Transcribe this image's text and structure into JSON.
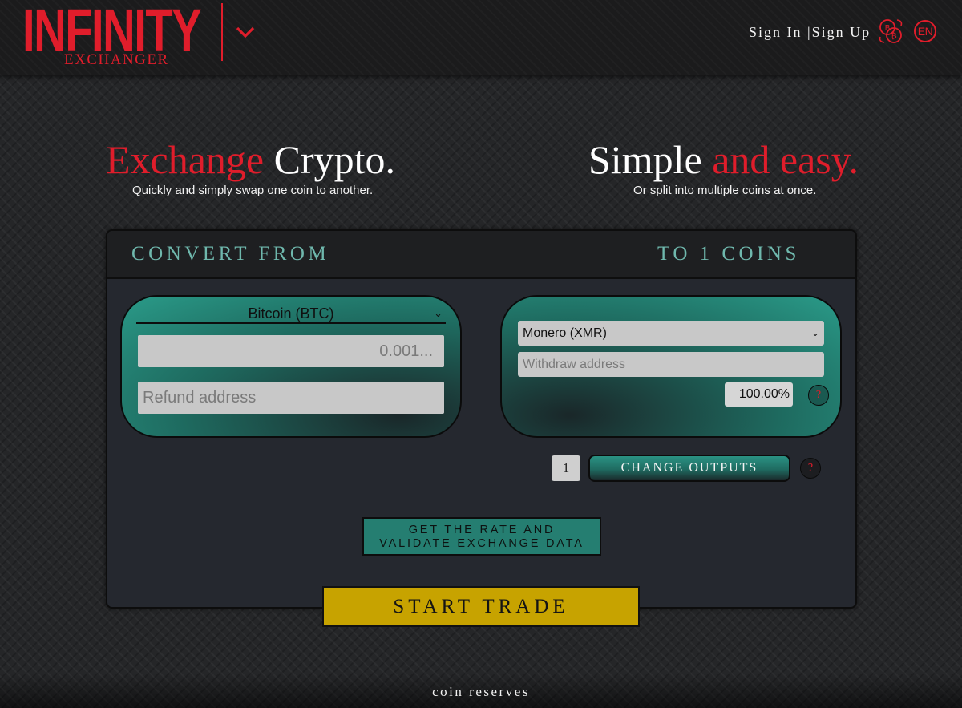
{
  "brand": {
    "name": "INFINITY",
    "tagline": "EXCHANGER",
    "color": "#e01d2b"
  },
  "nav": {
    "sign_in": "Sign In",
    "separator": "|",
    "sign_up": "Sign Up",
    "language": "EN",
    "coins_icon": "coins-icon"
  },
  "hero": {
    "left_title_red": "Exchange",
    "left_title_white": "Crypto.",
    "left_subtitle": "Quickly and simply swap one coin to another.",
    "right_title_white": "Simple",
    "right_title_red": "and easy.",
    "right_subtitle": "Or split into multiple coins at once."
  },
  "panel": {
    "from_label": "CONVERT FROM",
    "to_label": "TO 1 COINS",
    "from": {
      "coin": "Bitcoin (BTC)",
      "amount_placeholder": "0.001...",
      "refund_placeholder": "Refund address"
    },
    "to": {
      "coin": "Monero (XMR)",
      "withdraw_placeholder": "Withdraw address",
      "percent": "100.00",
      "percent_unit": "%",
      "help": "?"
    },
    "outputs": {
      "count": "1",
      "change_label": "CHANGE OUTPUTS",
      "help": "?"
    },
    "rate_button": {
      "line1": "GET THE RATE AND",
      "line2": "VALIDATE EXCHANGE DATA"
    }
  },
  "start_trade": "START TRADE",
  "footer": {
    "reserves": "coin reserves"
  },
  "colors": {
    "accent_teal": "#2a9b89",
    "start_gold": "#c7a300",
    "header_text": "#6fb8ad"
  }
}
